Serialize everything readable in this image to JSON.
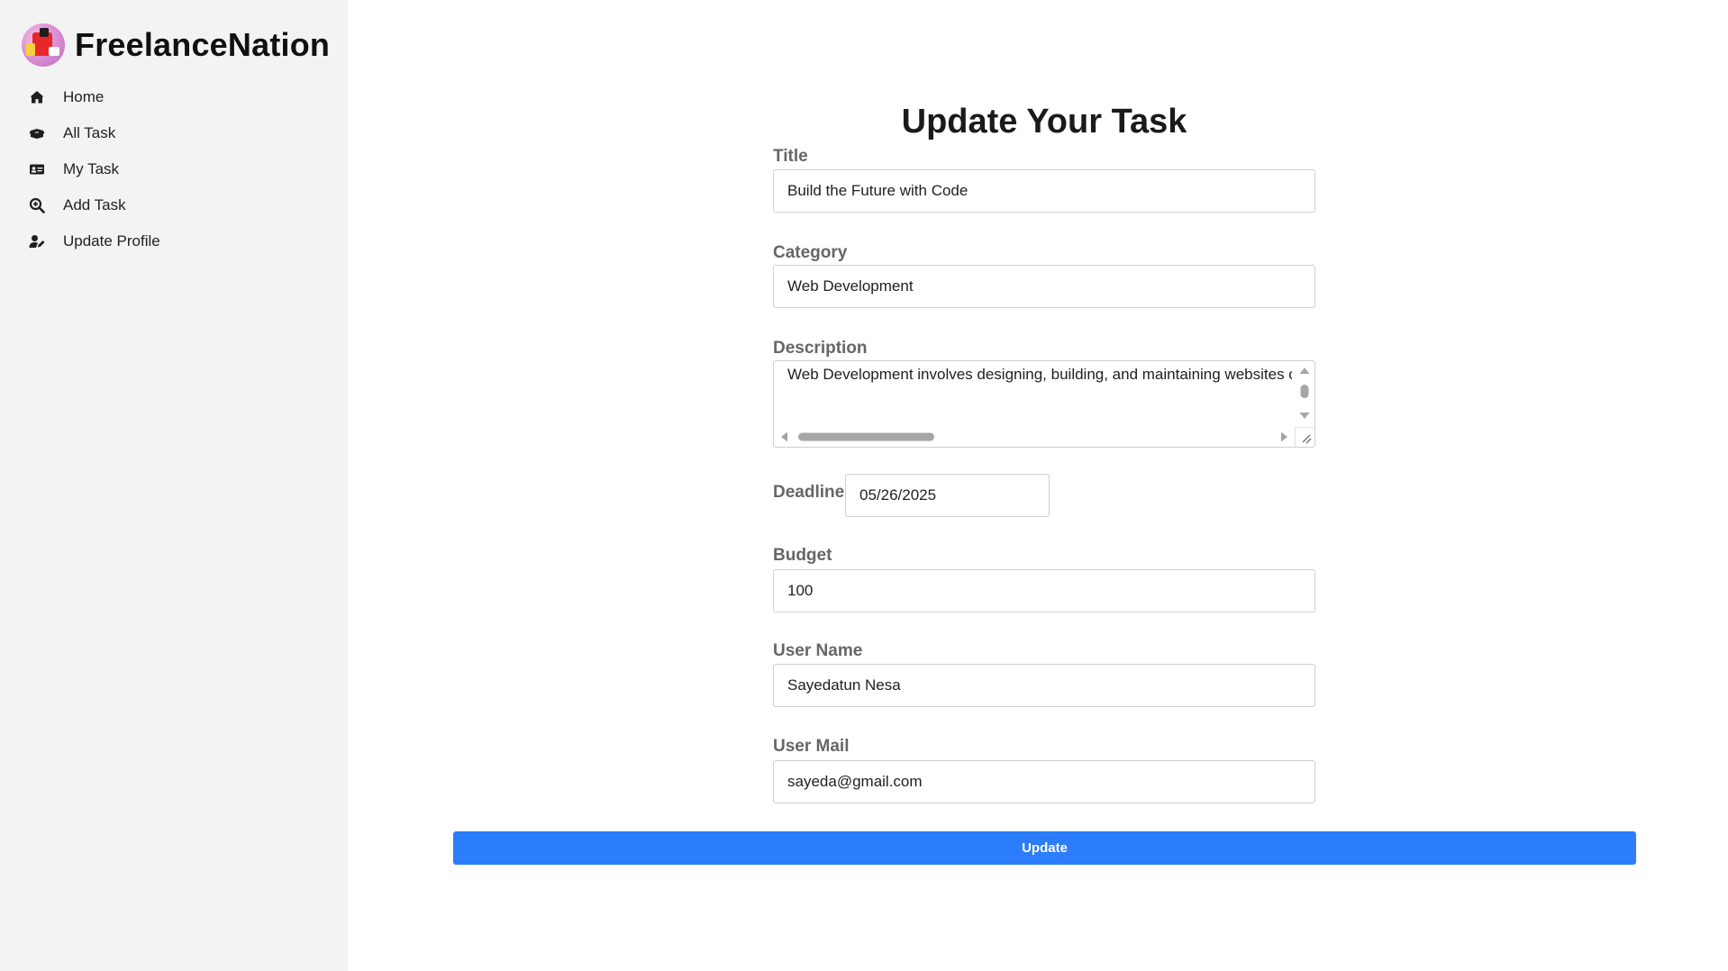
{
  "brand": {
    "name": "FreelanceNation",
    "logo_icon": "app-logo-illustration"
  },
  "sidebar": {
    "items": [
      {
        "label": "Home",
        "icon": "home-icon"
      },
      {
        "label": "All Task",
        "icon": "box-open-icon"
      },
      {
        "label": "My Task",
        "icon": "id-card-icon"
      },
      {
        "label": "Add Task",
        "icon": "search-plus-icon"
      },
      {
        "label": "Update Profile",
        "icon": "user-edit-icon"
      }
    ]
  },
  "form": {
    "title": "Update Your Task",
    "fields": {
      "title": {
        "label": "Title",
        "value": "Build the Future with Code"
      },
      "category": {
        "label": "Category",
        "value": "Web Development"
      },
      "description": {
        "label": "Description",
        "value": "Web Development involves designing, building, and maintaining websites o"
      },
      "deadline": {
        "label": "Deadline",
        "value": "05/26/2025"
      },
      "budget": {
        "label": "Budget",
        "value": "100"
      },
      "user_name": {
        "label": "User Name",
        "value": "Sayedatun Nesa"
      },
      "user_mail": {
        "label": "User Mail",
        "value": "sayeda@gmail.com"
      }
    },
    "submit_label": "Update"
  },
  "colors": {
    "sidebar_bg": "#f3f3f3",
    "label_gray": "#666666",
    "button_blue": "#2b7dfb",
    "input_border": "#cfcfcf"
  }
}
